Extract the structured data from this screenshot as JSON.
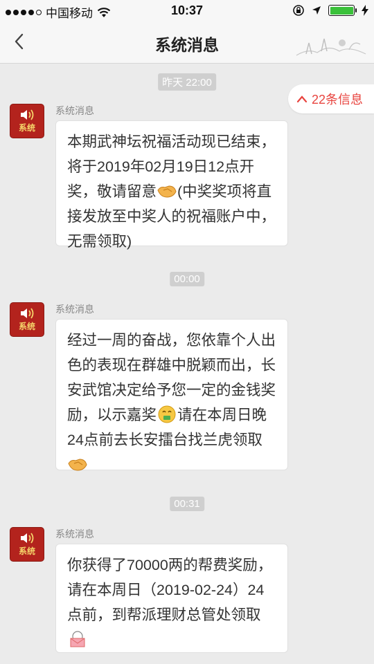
{
  "status_bar": {
    "carrier": "中国移动",
    "time": "10:37"
  },
  "header": {
    "title": "系统消息"
  },
  "unread": {
    "label": "22条信息",
    "accent_color": "#e8443f"
  },
  "timestamps": [
    "昨天 22:00",
    "00:00",
    "00:31"
  ],
  "avatar_label": "系统",
  "messages": [
    {
      "sender": "系统消息",
      "parts": [
        "本期武神坛祝福活动现已结束，将于2019年02月19日12点开奖，敬请留意",
        "(中奖奖项将直接发放至中奖人的祝福账户中，无需领取)"
      ],
      "emojis": [
        "handshake-emoji"
      ]
    },
    {
      "sender": "系统消息",
      "parts": [
        "经过一周的奋战，您依靠个人出色的表现在群雄中脱颖而出，长安武馆决定给予您一定的金钱奖励，以示嘉奖",
        "请在本周日晚24点前去长安擂台找兰虎领取"
      ],
      "emojis": [
        "money-mouth-emoji",
        "handshake-emoji"
      ]
    },
    {
      "sender": "系统消息",
      "parts": [
        "你获得了70000两的帮费奖励，请在本周日（2019-02-24）24点前，到帮派理财总管处领取"
      ],
      "emojis": [
        "envelope-emoji"
      ]
    }
  ]
}
